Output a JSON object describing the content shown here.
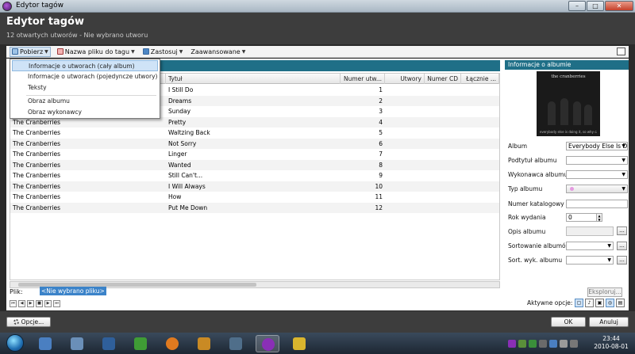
{
  "window": {
    "title": "Edytor tagów",
    "controls": [
      "–",
      "□",
      "✕"
    ]
  },
  "header": {
    "title": "Edytor tagów",
    "subtitle": "12 otwartych utworów - Nie wybrano utworu"
  },
  "toolbar": {
    "items": [
      {
        "label": "Pobierz"
      },
      {
        "label": "Nazwa pliku do tagu"
      },
      {
        "label": "Zastosuj"
      },
      {
        "label": "Zaawansowane"
      }
    ]
  },
  "menu": {
    "items": [
      "Informacje o utworach (cały album)",
      "Informacje o utworach (pojedyncze utwory)",
      "Teksty",
      "Obraz albumu",
      "Obraz wykonawcy"
    ]
  },
  "grid": {
    "columns": [
      "Tytuł",
      "Numer utw...",
      "Utwory",
      "Numer CD",
      "Łącznie ..."
    ],
    "rows": [
      {
        "artist": "",
        "title": "I Still Do",
        "track": "1"
      },
      {
        "artist": "",
        "title": "Dreams",
        "track": "2"
      },
      {
        "artist": "",
        "title": "Sunday",
        "track": "3"
      },
      {
        "artist": "The Cranberries",
        "title": "Pretty",
        "track": "4"
      },
      {
        "artist": "The Cranberries",
        "title": "Waltzing Back",
        "track": "5"
      },
      {
        "artist": "The Cranberries",
        "title": "Not Sorry",
        "track": "6"
      },
      {
        "artist": "The Cranberries",
        "title": "Linger",
        "track": "7"
      },
      {
        "artist": "The Cranberries",
        "title": "Wanted",
        "track": "8"
      },
      {
        "artist": "The Cranberries",
        "title": "Still Can't...",
        "track": "9"
      },
      {
        "artist": "The Cranberries",
        "title": "I Will Always",
        "track": "10"
      },
      {
        "artist": "The Cranberries",
        "title": "How",
        "track": "11"
      },
      {
        "artist": "The Cranberries",
        "title": "Put Me Down",
        "track": "12"
      }
    ]
  },
  "album_panel": {
    "title": "Informacje o albumie",
    "cover_title": "the cranberries",
    "cover_caption": "everybody else is doing it, so why can't we?",
    "fields": {
      "album": {
        "label": "Album",
        "value": "Everybody Else Is D"
      },
      "subtitle": {
        "label": "Podtytuł albumu",
        "value": ""
      },
      "artist": {
        "label": "Wykonawca albumu",
        "value": ""
      },
      "type": {
        "label": "Typ albumu",
        "value": ""
      },
      "catalog": {
        "label": "Numer katalogowy",
        "value": ""
      },
      "year": {
        "label": "Rok wydania",
        "value": "0"
      },
      "description": {
        "label": "Opis albumu",
        "value": ""
      },
      "sort_album": {
        "label": "Sortowanie albumów",
        "value": ""
      },
      "sort_artist": {
        "label": "Sort. wyk. albumu",
        "value": ""
      }
    },
    "dots": "..."
  },
  "file": {
    "label": "Plik:",
    "value": "<Nie wybrano pliku>",
    "explore_label": "Eksploruj..."
  },
  "active_options_label": "Aktywne opcje:",
  "buttons": {
    "options": "Opcje...",
    "ok": "OK",
    "cancel": "Anuluj"
  },
  "taskbar": {
    "time": "23:44",
    "date": "2010-08-01"
  },
  "colors": {
    "header_bg": "#3d3d3d",
    "accent": "#1f6f87",
    "selection": "#3b83c9"
  }
}
